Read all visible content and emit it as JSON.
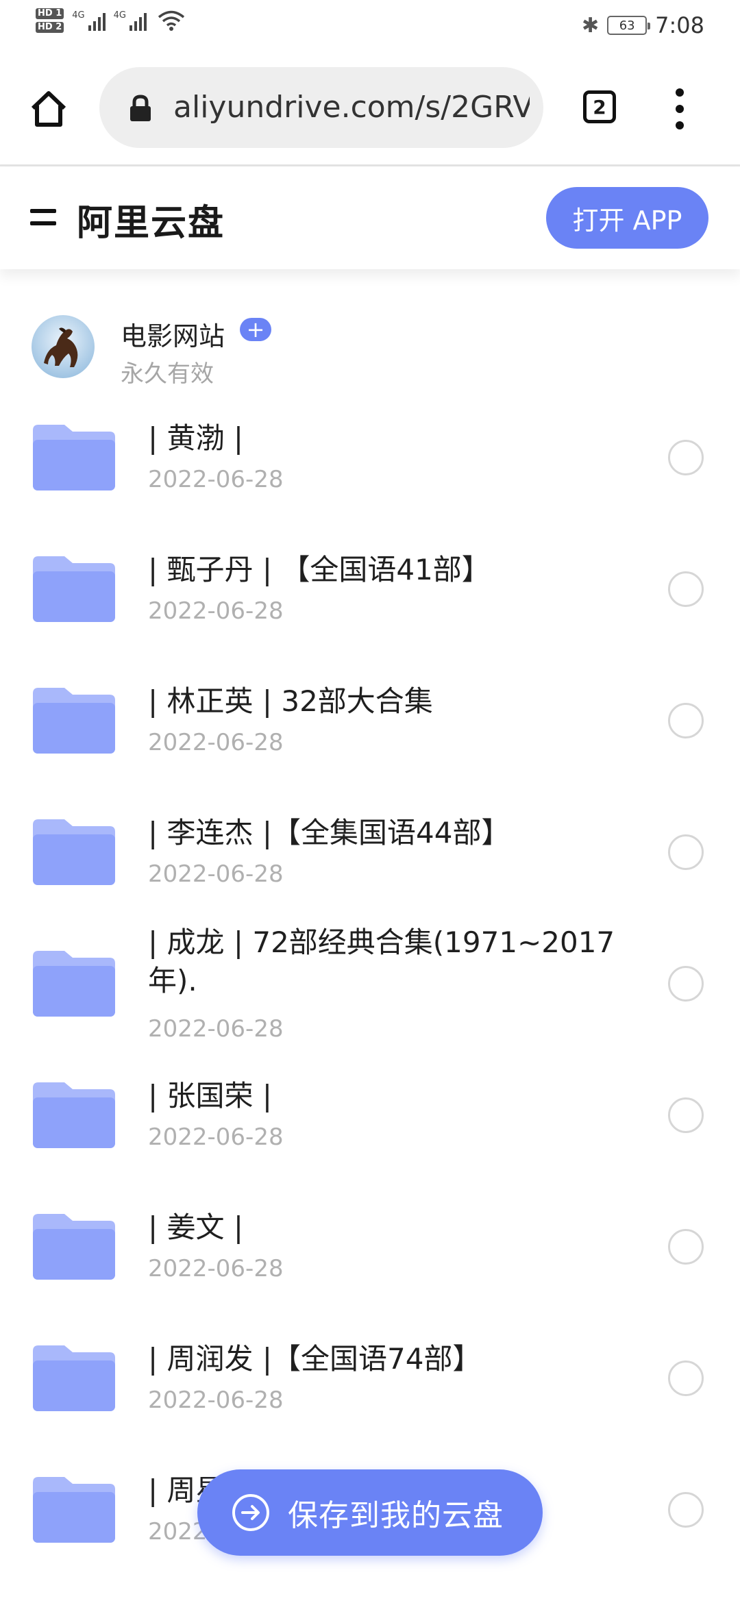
{
  "status_bar": {
    "hd1": "HD 1",
    "hd2": "HD 2",
    "net1": "4G",
    "net2": "4G",
    "battery": "63",
    "time": "7:08"
  },
  "browser": {
    "url": "aliyundrive.com/s/2GRV",
    "tab_count": "2"
  },
  "header": {
    "title": "阿里云盘",
    "open_app": "打开 APP"
  },
  "share": {
    "owner": "电影网站",
    "plus": "+",
    "validity": "永久有效"
  },
  "files": [
    {
      "name": "| 黄渤 |",
      "date": "2022-06-28"
    },
    {
      "name": "| 甄子丹 | 【全国语41部】",
      "date": "2022-06-28"
    },
    {
      "name": "| 林正英 | 32部大合集",
      "date": "2022-06-28"
    },
    {
      "name": "| 李连杰 |【全集国语44部】",
      "date": "2022-06-28"
    },
    {
      "name": "| 成龙 | 72部经典合集(1971~2017年).",
      "date": "2022-06-28"
    },
    {
      "name": "| 张国荣 |",
      "date": "2022-06-28"
    },
    {
      "name": "| 姜文 |",
      "date": "2022-06-28"
    },
    {
      "name": "| 周润发 |【全国语74部】",
      "date": "2022-06-28"
    },
    {
      "name": "| 周星",
      "date": "2022"
    }
  ],
  "save_button": "保存到我的云盘",
  "colors": {
    "accent": "#6a83f5",
    "folder_light": "#b3c1fb",
    "folder_dark": "#8fa3fa"
  }
}
